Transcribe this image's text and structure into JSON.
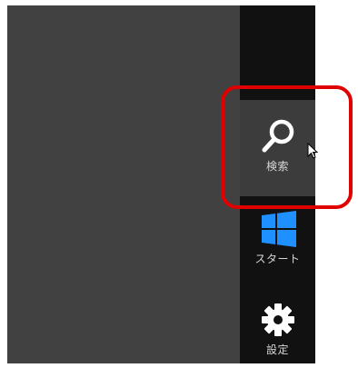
{
  "charms": {
    "search": {
      "label": "検索",
      "icon": "search-icon"
    },
    "start": {
      "label": "スタート",
      "icon": "windows-logo-icon"
    },
    "settings": {
      "label": "設定",
      "icon": "gear-icon"
    }
  },
  "colors": {
    "desktop": "#414141",
    "charm_bar": "#111111",
    "search_hover": "#3c3c3c",
    "label": "#d6d6d6",
    "windows_logo": "#1e90ff",
    "highlight": "#e00000"
  }
}
